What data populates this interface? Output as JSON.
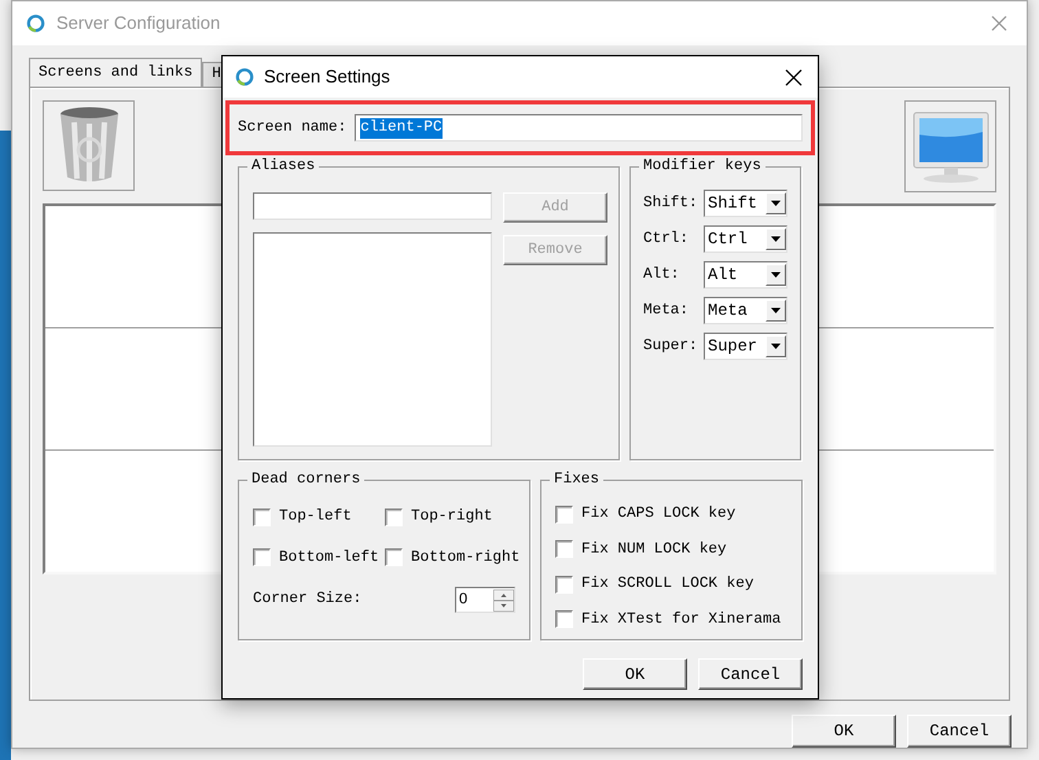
{
  "window": {
    "title": "Server Configuration"
  },
  "tabs": [
    {
      "label": "Screens and links",
      "selected": true
    },
    {
      "label": "H",
      "selected": false
    }
  ],
  "buttons": [
    "OK",
    "Cancel"
  ],
  "dialog": {
    "title": "Screen Settings",
    "screen_name": {
      "label": "Screen name:",
      "value": "client-PC"
    },
    "aliases": {
      "title": "Aliases",
      "buttons": [
        {
          "label": "Add",
          "disabled": true
        },
        {
          "label": "Remove",
          "disabled": true
        }
      ]
    },
    "modifier_keys": {
      "title": "Modifier keys",
      "rows": [
        {
          "label": "Shift:",
          "value": "Shift"
        },
        {
          "label": "Ctrl:",
          "value": "Ctrl"
        },
        {
          "label": "Alt:",
          "value": "Alt"
        },
        {
          "label": "Meta:",
          "value": "Meta"
        },
        {
          "label": "Super:",
          "value": "Super"
        }
      ]
    },
    "dead_corners": {
      "title": "Dead corners",
      "options": [
        {
          "label": "Top-left",
          "checked": false
        },
        {
          "label": "Top-right",
          "checked": false
        },
        {
          "label": "Bottom-left",
          "checked": false
        },
        {
          "label": "Bottom-right",
          "checked": false
        }
      ],
      "corner_size": {
        "label": "Corner Size:",
        "value": "0"
      }
    },
    "fixes": {
      "title": "Fixes",
      "options": [
        {
          "label": "Fix CAPS LOCK key",
          "checked": false
        },
        {
          "label": "Fix NUM LOCK key",
          "checked": false
        },
        {
          "label": "Fix SCROLL LOCK key",
          "checked": false
        },
        {
          "label": "Fix XTest for Xinerama",
          "checked": false
        }
      ]
    },
    "buttons": [
      "OK",
      "Cancel"
    ]
  }
}
